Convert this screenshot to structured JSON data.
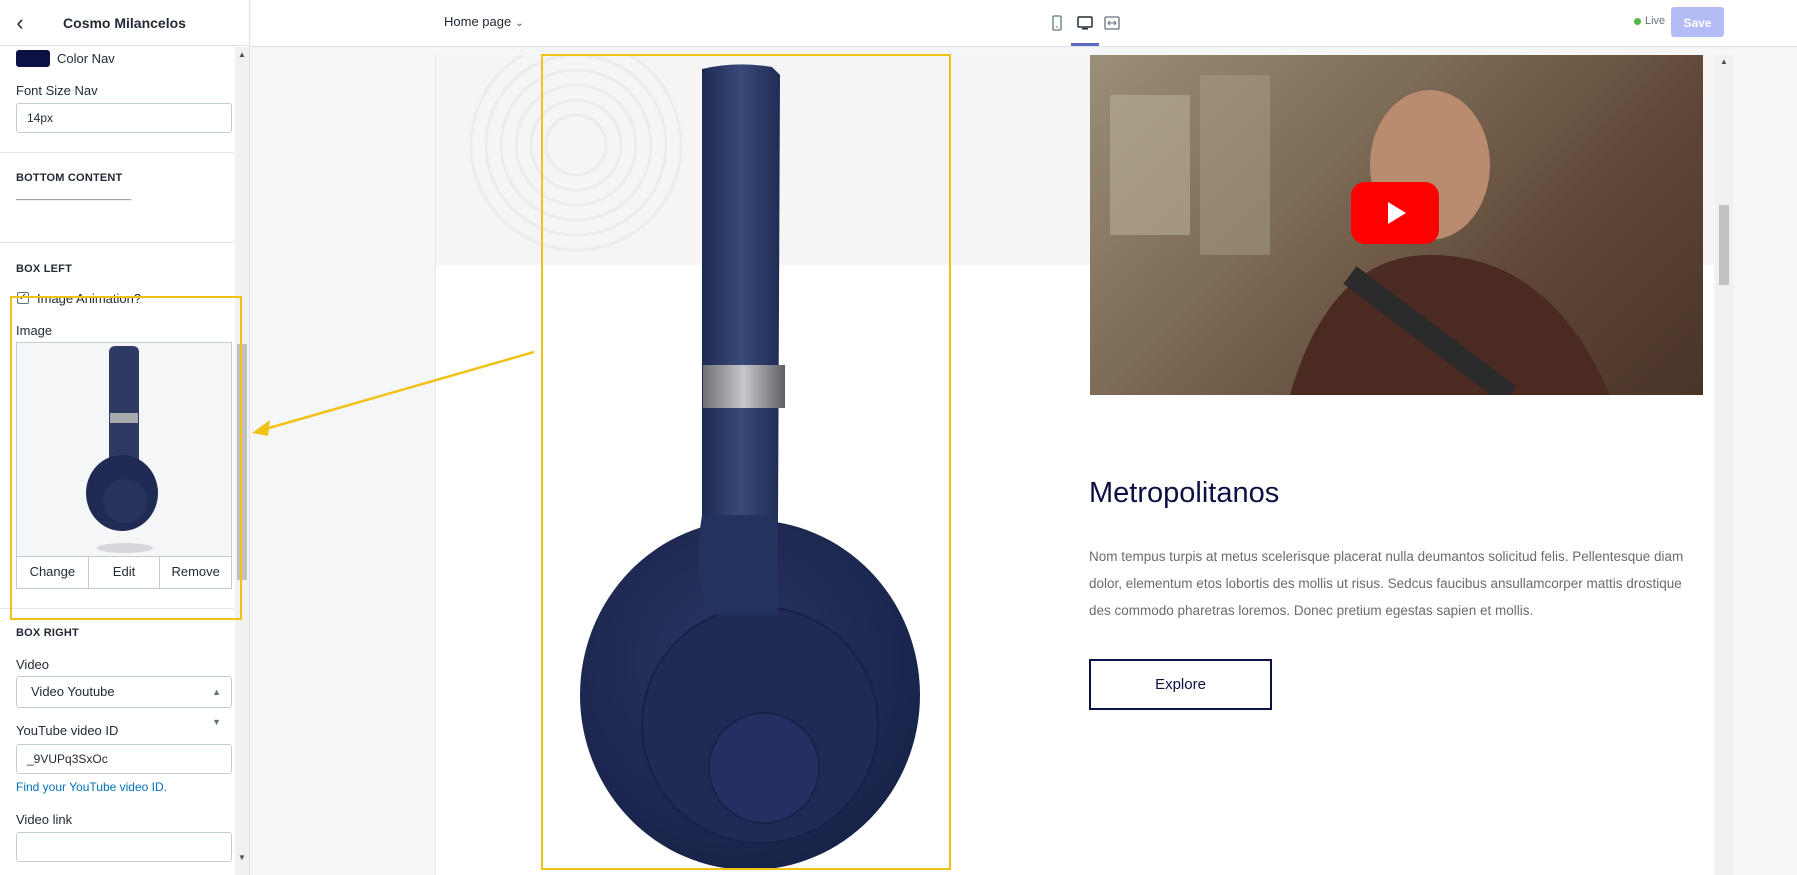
{
  "sidebar": {
    "title": "Cosmo Milancelos",
    "color_nav_label": "Color Nav",
    "color_nav_value": "#0b1142",
    "font_size_nav_label": "Font Size Nav",
    "font_size_nav_value": "14px",
    "bottom_content_heading": "BOTTOM CONTENT",
    "bottom_content_divider": "_______________________",
    "box_left_heading": "BOX LEFT",
    "image_animation_label": "Image Animation?",
    "image_animation_checked": true,
    "image_label": "Image",
    "image_actions": {
      "change": "Change",
      "edit": "Edit",
      "remove": "Remove"
    },
    "box_right_heading": "BOX RIGHT",
    "video_label": "Video",
    "video_value": "Video Youtube",
    "youtube_id_label": "YouTube video ID",
    "youtube_id_value": "_9VUPq3SxOc",
    "find_id_link": "Find your YouTube video ID.",
    "video_link_label": "Video link",
    "video_link_value": ""
  },
  "topbar": {
    "page_select": "Home page",
    "live_label": "Live",
    "save_label": "Save",
    "active_device": "desktop",
    "devices": [
      "mobile-icon",
      "desktop-icon",
      "full-width-icon"
    ]
  },
  "preview": {
    "heading": "Metropolitanos",
    "description": "Nom tempus turpis at metus scelerisque placerat nulla deumantos solicitud felis. Pellentesque diam dolor, elementum etos lobortis des mollis ut risus. Sedcus faucibus ansullamcorper mattis drostique des commodo pharetras loremos. Donec pretium egestas sapien et mollis.",
    "button_label": "Explore"
  },
  "colors": {
    "accent": "#5c6ac4",
    "highlight": "#f1c216",
    "brand_navy": "#0b1142",
    "youtube_red": "#ff0000",
    "live_green": "#50b83c"
  }
}
